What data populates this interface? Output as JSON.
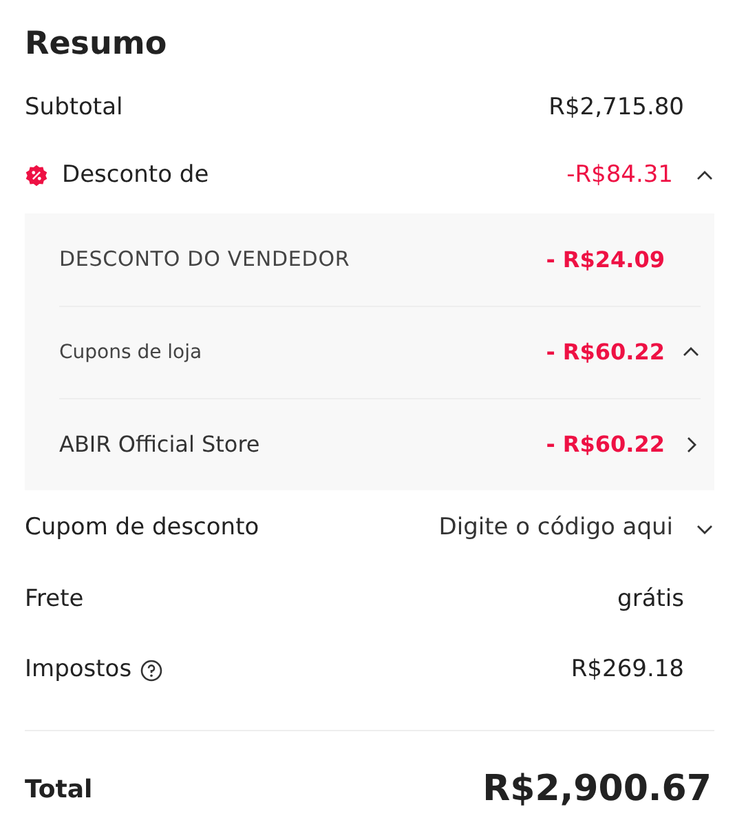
{
  "title": "Resumo",
  "subtotal": {
    "label": "Subtotal",
    "value": "R$2,715.80"
  },
  "discount": {
    "label": "Desconto de",
    "value": "-R$84.31",
    "expanded": true,
    "items": [
      {
        "kind": "plain",
        "label": "DESCONTO DO VENDEDOR",
        "value": "- R$24.09"
      },
      {
        "kind": "group",
        "label": "Cupons de loja",
        "value": "- R$60.22",
        "expanded": true
      },
      {
        "kind": "link",
        "label": "ABIR Official Store",
        "value": "- R$60.22"
      }
    ]
  },
  "coupon": {
    "label": "Cupom de desconto",
    "placeholder": "Digite o código aqui"
  },
  "shipping": {
    "label": "Frete",
    "value": "grátis"
  },
  "taxes": {
    "label": "Impostos",
    "value": "R$269.18"
  },
  "total": {
    "label": "Total",
    "value": "R$2,900.67"
  }
}
